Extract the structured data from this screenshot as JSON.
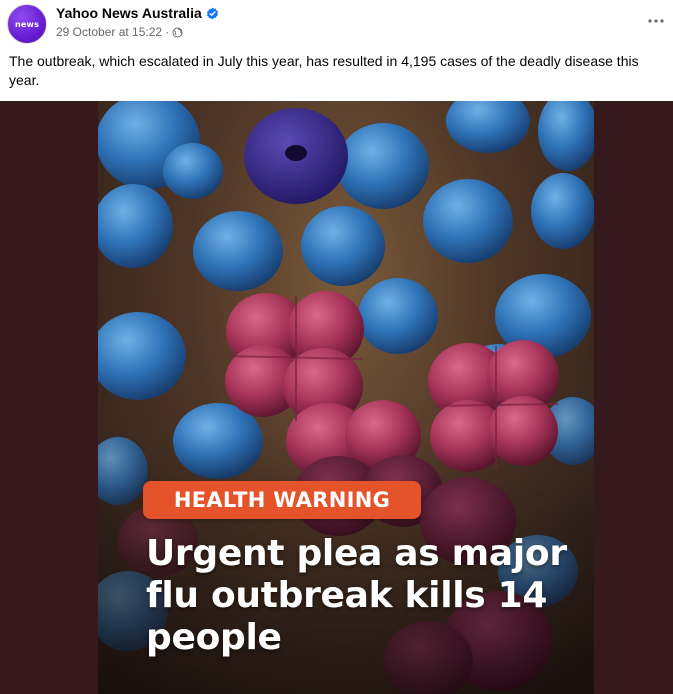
{
  "post": {
    "page_name": "Yahoo News Australia",
    "avatar_text": "news",
    "timestamp": "29 October at 15:22",
    "separator": "·",
    "text": "The outbreak, which escalated in July this year, has resulted in 4,195 cases of the deadly disease this year."
  },
  "video": {
    "badge": "HEALTH WARNING",
    "headline": "Urgent plea as major flu outbreak kills 14 people"
  },
  "icons": {
    "verified": "verified-badge-icon",
    "privacy": "globe-icon",
    "more": "more-options-icon"
  },
  "colors": {
    "badge": "#e5532b",
    "media_background": "#35191d",
    "verified": "#1877f2",
    "secondary_text": "#65676b"
  }
}
